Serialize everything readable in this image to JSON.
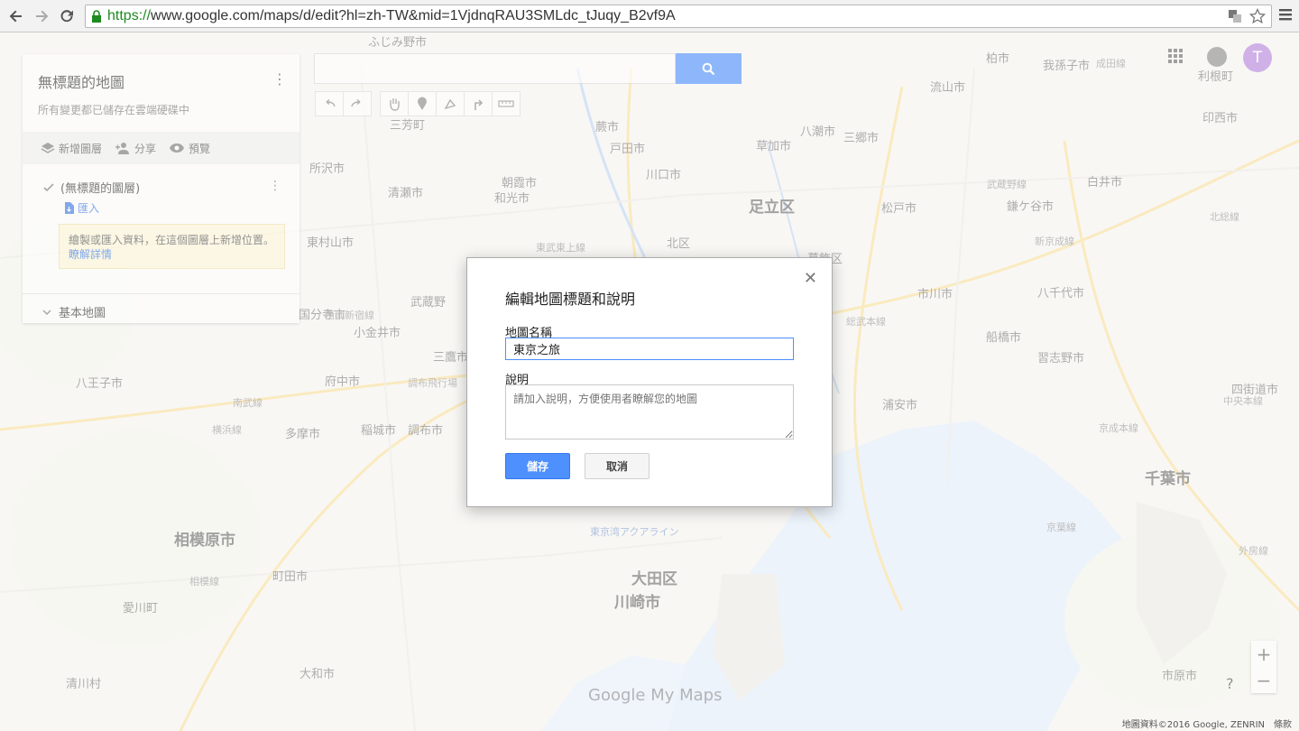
{
  "browser": {
    "url_scheme": "https://",
    "url_rest": "www.google.com/maps/d/edit?hl=zh-TW&mid=1VjdnqRAU3SMLdc_tJuqy_B2vf9A"
  },
  "panel": {
    "title": "無標題的地圖",
    "status": "所有變更都已儲存在雲端硬碟中",
    "actions": {
      "add_layer": "新增圖層",
      "share": "分享",
      "preview": "預覽"
    },
    "layer": {
      "name": "(無標題的圖層)",
      "import": "匯入"
    },
    "hint": {
      "text": "繪製或匯入資料，在這個圖層上新增位置。",
      "link": "瞭解詳情"
    },
    "basemap": "基本地圖"
  },
  "user": {
    "initial": "T"
  },
  "map": {
    "labels": [
      {
        "text": "ふじみ野市",
        "cls": ""
      },
      {
        "text": "所沢市",
        "cls": ""
      },
      {
        "text": "清瀬市",
        "cls": ""
      },
      {
        "text": "東村山市",
        "cls": ""
      },
      {
        "text": "国分寺市",
        "cls": ""
      },
      {
        "text": "小金井市",
        "cls": ""
      },
      {
        "text": "府中市",
        "cls": ""
      },
      {
        "text": "八王子市",
        "cls": ""
      },
      {
        "text": "多摩市",
        "cls": ""
      },
      {
        "text": "稲城市",
        "cls": ""
      },
      {
        "text": "調布市",
        "cls": ""
      },
      {
        "text": "三鷹市",
        "cls": ""
      },
      {
        "text": "相模原市",
        "cls": "big"
      },
      {
        "text": "町田市",
        "cls": ""
      },
      {
        "text": "大和市",
        "cls": ""
      },
      {
        "text": "愛川町",
        "cls": ""
      },
      {
        "text": "清川村",
        "cls": ""
      },
      {
        "text": "三芳町",
        "cls": ""
      },
      {
        "text": "蕨市",
        "cls": ""
      },
      {
        "text": "戸田市",
        "cls": ""
      },
      {
        "text": "川口市",
        "cls": ""
      },
      {
        "text": "朝霞市",
        "cls": ""
      },
      {
        "text": "和光市",
        "cls": ""
      },
      {
        "text": "足立区",
        "cls": "big"
      },
      {
        "text": "北区",
        "cls": ""
      },
      {
        "text": "草加市",
        "cls": ""
      },
      {
        "text": "八潮市",
        "cls": ""
      },
      {
        "text": "三郷市",
        "cls": ""
      },
      {
        "text": "流山市",
        "cls": ""
      },
      {
        "text": "柏市",
        "cls": ""
      },
      {
        "text": "我孫子市",
        "cls": ""
      },
      {
        "text": "成田線",
        "cls": "road"
      },
      {
        "text": "利根町",
        "cls": ""
      },
      {
        "text": "印西市",
        "cls": ""
      },
      {
        "text": "白井市",
        "cls": ""
      },
      {
        "text": "鎌ケ谷市",
        "cls": ""
      },
      {
        "text": "松戸市",
        "cls": ""
      },
      {
        "text": "市川市",
        "cls": ""
      },
      {
        "text": "八千代市",
        "cls": ""
      },
      {
        "text": "船橋市",
        "cls": ""
      },
      {
        "text": "習志野市",
        "cls": ""
      },
      {
        "text": "浦安市",
        "cls": ""
      },
      {
        "text": "千葉市",
        "cls": "big"
      },
      {
        "text": "四街道市",
        "cls": ""
      },
      {
        "text": "市原市",
        "cls": ""
      },
      {
        "text": "大田区",
        "cls": "big"
      },
      {
        "text": "川崎市",
        "cls": "big"
      },
      {
        "text": "葛飾区",
        "cls": ""
      },
      {
        "text": "武蔵野線",
        "cls": "road"
      },
      {
        "text": "武蔵野",
        "cls": ""
      },
      {
        "text": "中央本線",
        "cls": "road"
      },
      {
        "text": "京成本線",
        "cls": "road"
      },
      {
        "text": "総武本線",
        "cls": "road"
      },
      {
        "text": "京葉線",
        "cls": "road"
      },
      {
        "text": "外房線",
        "cls": "road"
      },
      {
        "text": "横浜線",
        "cls": "road"
      },
      {
        "text": "南武線",
        "cls": "road"
      },
      {
        "text": "西武新宿線",
        "cls": "road"
      },
      {
        "text": "東武東上線",
        "cls": "road"
      },
      {
        "text": "北総線",
        "cls": "road"
      },
      {
        "text": "新京成線",
        "cls": "road"
      },
      {
        "text": "調布飛行場",
        "cls": "road"
      },
      {
        "text": "東京湾アクアライン",
        "cls": "water"
      },
      {
        "text": "相模線",
        "cls": "road"
      }
    ]
  },
  "watermark": "Google My Maps",
  "footer": {
    "attribution": "地圖資料©2016 Google, ZENRIN",
    "terms": "條款"
  },
  "dialog": {
    "title": "編輯地圖標題和說明",
    "name_label": "地圖名稱",
    "name_value": "東京之旅",
    "desc_label": "說明",
    "desc_placeholder": "請加入說明，方便使用者瞭解您的地圖",
    "save": "儲存",
    "cancel": "取消"
  }
}
